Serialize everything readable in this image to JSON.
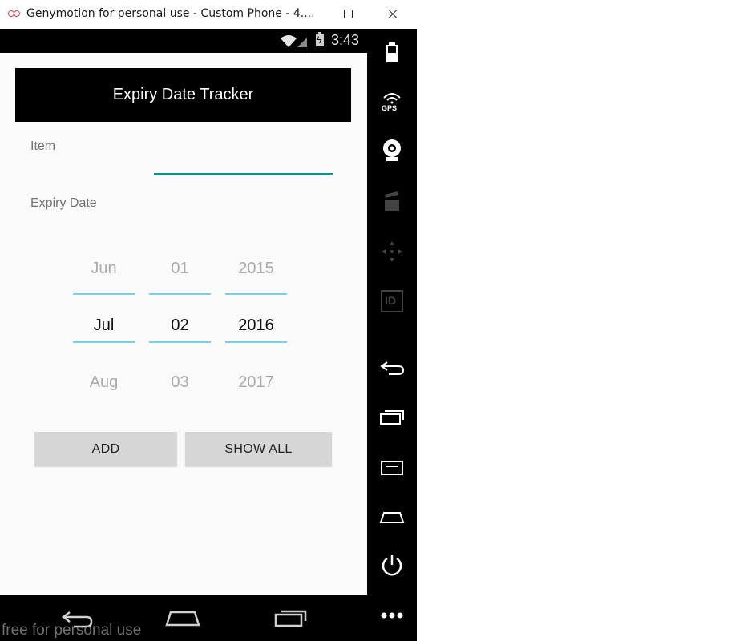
{
  "window": {
    "title": "Genymotion for personal use - Custom Phone - 4....",
    "controls": [
      "minimize-icon",
      "maximize-icon",
      "close-icon"
    ]
  },
  "status_bar": {
    "time": "3:43",
    "icons": [
      "wifi-icon",
      "signal-icon",
      "battery-charging-icon"
    ]
  },
  "app": {
    "title": "Expiry Date Tracker",
    "item_label": "Item",
    "item_value": "",
    "expiry_label": "Expiry Date",
    "date_picker": {
      "month": {
        "prev": "Jun",
        "selected": "Jul",
        "next": "Aug"
      },
      "day": {
        "prev": "01",
        "selected": "02",
        "next": "03"
      },
      "year": {
        "prev": "2015",
        "selected": "2016",
        "next": "2017"
      }
    },
    "buttons": {
      "add": "ADD",
      "show_all": "SHOW ALL"
    }
  },
  "nav_bar": {
    "icons": [
      "back-icon",
      "home-icon",
      "recent-apps-icon"
    ]
  },
  "watermark": "free for personal use",
  "genymotion_toolbar": {
    "icons": [
      "battery-icon",
      "gps-icon",
      "camera-icon",
      "video-capture-icon",
      "dpad-icon",
      "id-icon",
      "back-icon",
      "recent-apps-icon",
      "menu-icon",
      "home-icon",
      "power-icon",
      "more-icon"
    ],
    "gps_label": "GPS",
    "id_label": "ID"
  },
  "colors": {
    "accent": "#009688",
    "picker_divider": "#7fcfe0",
    "header_bg": "#000000",
    "button_bg": "#d6d6d6"
  }
}
